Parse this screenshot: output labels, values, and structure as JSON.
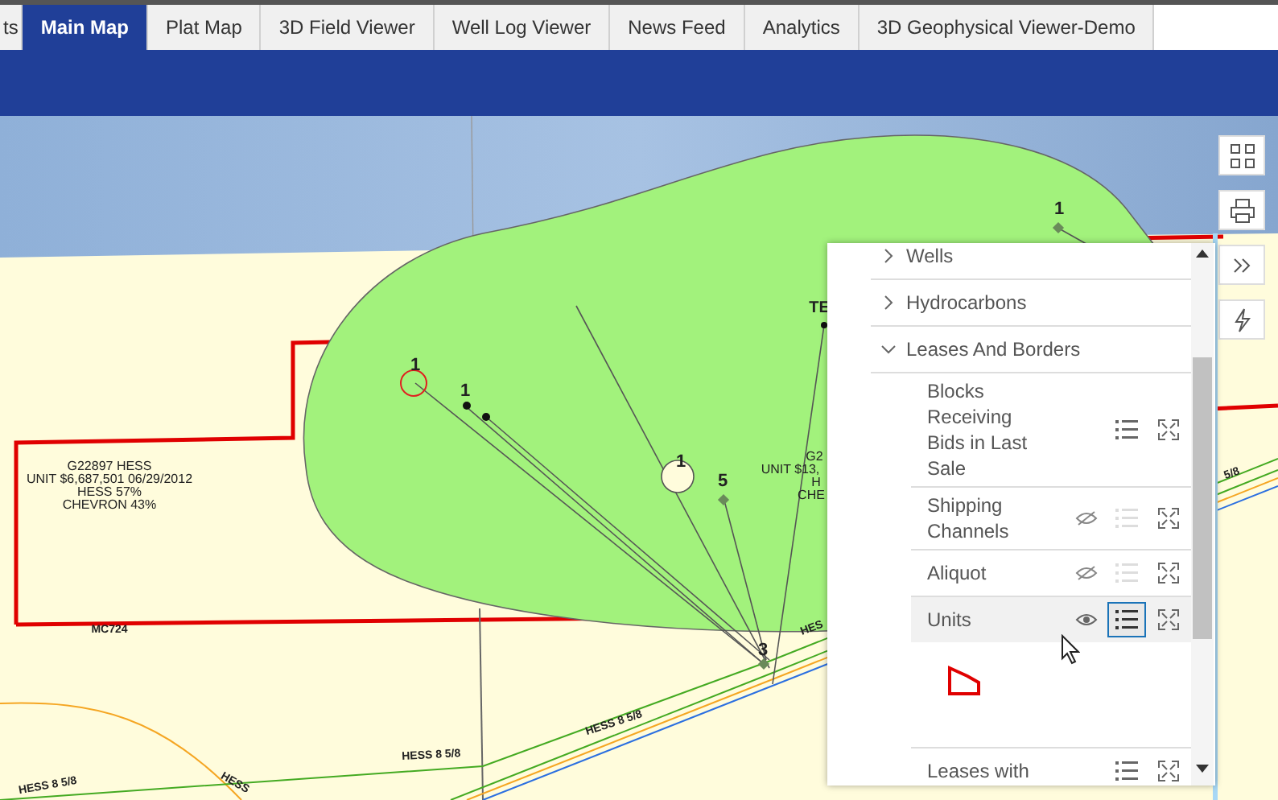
{
  "tabs": [
    {
      "label": "ts",
      "selected": false
    },
    {
      "label": "Main Map",
      "selected": true
    },
    {
      "label": "Plat Map",
      "selected": false
    },
    {
      "label": "3D Field Viewer",
      "selected": false
    },
    {
      "label": "Well Log Viewer",
      "selected": false
    },
    {
      "label": "News Feed",
      "selected": false
    },
    {
      "label": "Analytics",
      "selected": false
    },
    {
      "label": "3D Geophysical Viewer-Demo",
      "selected": false
    }
  ],
  "map_labels": [
    {
      "text": "1"
    },
    {
      "text": "1"
    },
    {
      "text": "1"
    },
    {
      "text": "5"
    },
    {
      "text": "3"
    },
    {
      "text": "1"
    },
    {
      "text": "TE"
    },
    {
      "text": "G22897 HESS"
    },
    {
      "text": "UNIT $6,687,501 06/29/2012"
    },
    {
      "text": "HESS 57%"
    },
    {
      "text": "CHEVRON 43%"
    },
    {
      "text": "G2"
    },
    {
      "text": "UNIT $13,"
    },
    {
      "text": "H"
    },
    {
      "text": "CHE"
    },
    {
      "text": "MC724"
    },
    {
      "text": "HESS 8 5/8"
    },
    {
      "text": "HESS 8 5/8"
    },
    {
      "text": "HESS 8 5/8"
    },
    {
      "text": "HES"
    },
    {
      "text": "HESS"
    },
    {
      "text": "5/8"
    }
  ],
  "layers": [
    {
      "label": "Wells",
      "expanded": false
    },
    {
      "label": "Hydrocarbons",
      "expanded": false
    },
    {
      "label": "Leases And Borders",
      "expanded": true,
      "children": [
        {
          "label": "Blocks Receiving Bids in Last Sale",
          "visible": true,
          "hovered": false,
          "legend_open": false
        },
        {
          "label": "Shipping Channels",
          "visible": false,
          "hovered": false,
          "legend_open": false
        },
        {
          "label": "Aliquot",
          "visible": false,
          "hovered": false,
          "legend_open": false
        },
        {
          "label": "Units",
          "visible": true,
          "hovered": true,
          "legend_open": true
        },
        {
          "label": "Leases with",
          "visible": true,
          "hovered": false,
          "legend_open": false
        }
      ]
    }
  ]
}
